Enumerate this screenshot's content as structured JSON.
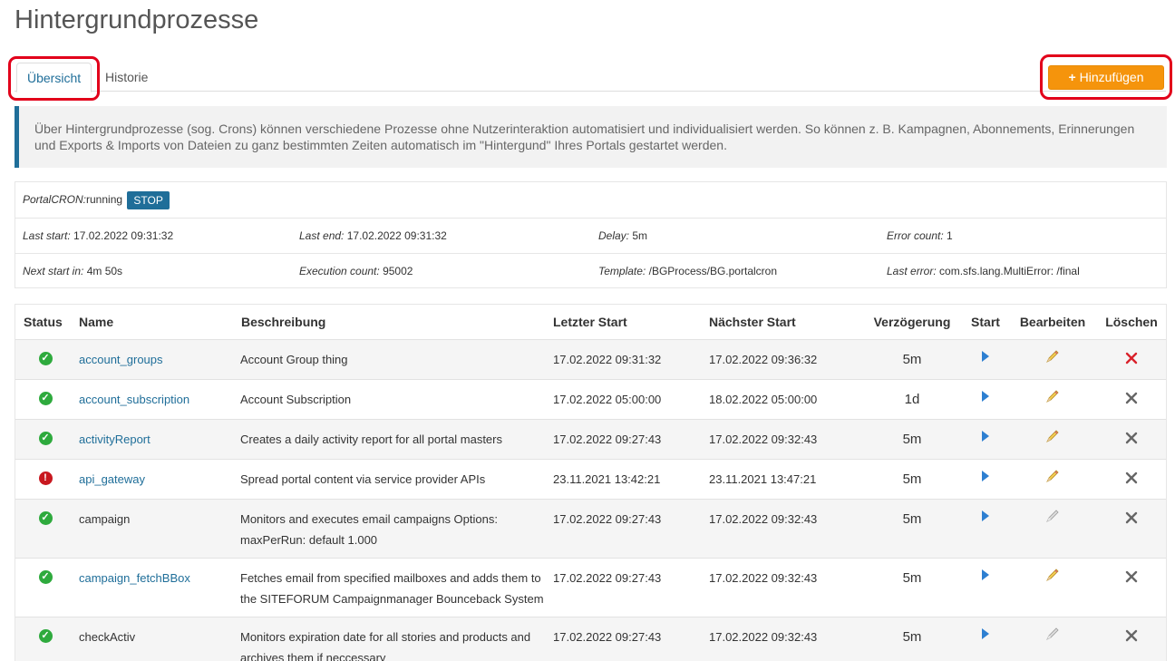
{
  "page": {
    "title": "Hintergrundprozesse"
  },
  "tabs": [
    {
      "label": "Übersicht"
    },
    {
      "label": "Historie"
    }
  ],
  "toolbar": {
    "add_label": "Hinzufügen"
  },
  "info": {
    "text": "Über Hintergrundprozesse (sog. Crons) können verschiedene Prozesse ohne Nutzerinteraktion automatisiert und individualisiert werden. So können z. B. Kampagnen, Abonnements, Erinnerungen und Exports & Imports von Dateien zu ganz bestimmten Zeiten automatisch im \"Hintergund\" Ihres Portals gestartet werden."
  },
  "cron": {
    "label": "PortalCRON:",
    "state": "running",
    "stop_label": "STOP",
    "last_start_label": "Last start:",
    "last_start": "17.02.2022 09:31:32",
    "last_end_label": "Last end:",
    "last_end": "17.02.2022 09:31:32",
    "delay_label": "Delay:",
    "delay": "5m",
    "error_count_label": "Error count:",
    "error_count": "1",
    "next_start_label": "Next start in:",
    "next_start": "4m 50s",
    "execution_count_label": "Execution count:",
    "execution_count": "95002",
    "template_label": "Template:",
    "template": "/BGProcess/BG.portalcron",
    "last_error_label": "Last error:",
    "last_error": "com.sfs.lang.MultiError: /final"
  },
  "table": {
    "headers": {
      "status": "Status",
      "name": "Name",
      "description": "Beschreibung",
      "last_start": "Letzter Start",
      "next_start": "Nächster Start",
      "delay": "Verzögerung",
      "start": "Start",
      "edit": "Bearbeiten",
      "delete": "Löschen"
    },
    "rows": [
      {
        "status": "ok",
        "name": "account_groups",
        "name_is_link": true,
        "description": "Account Group thing",
        "last_start": "17.02.2022 09:31:32",
        "next_start": "17.02.2022 09:36:32",
        "delay": "5m",
        "edit_enabled": true,
        "delete_highlight": true
      },
      {
        "status": "ok",
        "name": "account_subscription",
        "name_is_link": true,
        "description": "Account Subscription",
        "last_start": "17.02.2022 05:00:00",
        "next_start": "18.02.2022 05:00:00",
        "delay": "1d",
        "edit_enabled": true,
        "delete_highlight": false
      },
      {
        "status": "ok",
        "name": "activityReport",
        "name_is_link": true,
        "description": "Creates a daily activity report for all portal masters",
        "last_start": "17.02.2022 09:27:43",
        "next_start": "17.02.2022 09:32:43",
        "delay": "5m",
        "edit_enabled": true,
        "delete_highlight": false
      },
      {
        "status": "error",
        "name": "api_gateway",
        "name_is_link": true,
        "description": "Spread portal content via service provider APIs",
        "last_start": "23.11.2021 13:42:21",
        "next_start": "23.11.2021 13:47:21",
        "delay": "5m",
        "edit_enabled": true,
        "delete_highlight": false
      },
      {
        "status": "ok",
        "name": "campaign",
        "name_is_link": false,
        "description": "Monitors and executes email campaigns Options: maxPerRun: default 1.000",
        "last_start": "17.02.2022 09:27:43",
        "next_start": "17.02.2022 09:32:43",
        "delay": "5m",
        "edit_enabled": false,
        "delete_highlight": false
      },
      {
        "status": "ok",
        "name": "campaign_fetchBBox",
        "name_is_link": true,
        "description": "Fetches email from specified mailboxes and adds them to the SITEFORUM Campaignmanager Bounceback System",
        "last_start": "17.02.2022 09:27:43",
        "next_start": "17.02.2022 09:32:43",
        "delay": "5m",
        "edit_enabled": true,
        "delete_highlight": false
      },
      {
        "status": "ok",
        "name": "checkActiv",
        "name_is_link": false,
        "description": "Monitors expiration date for all stories and products and archives them if neccessary",
        "last_start": "17.02.2022 09:27:43",
        "next_start": "17.02.2022 09:32:43",
        "delay": "5m",
        "edit_enabled": false,
        "delete_highlight": false
      }
    ]
  },
  "icons": {
    "status_ok": "check-circle-icon",
    "status_error": "exclamation-circle-icon",
    "start": "play-icon",
    "edit": "pencil-icon",
    "delete": "close-x-icon",
    "add": "plus-icon"
  },
  "colors": {
    "accent": "#1f6e99",
    "add_button": "#f5940c",
    "ok": "#2eaa3d",
    "error": "#c8181f",
    "highlight": "#e2001a"
  }
}
